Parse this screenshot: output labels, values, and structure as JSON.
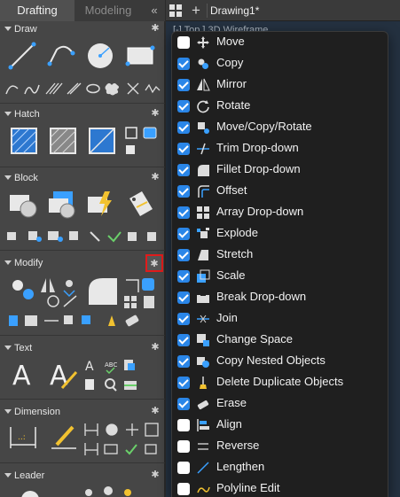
{
  "palette": {
    "tabs": [
      {
        "label": "Drafting",
        "active": true
      },
      {
        "label": "Modeling",
        "active": false
      }
    ],
    "collapse_glyph": "«",
    "sections": [
      {
        "title": "Draw",
        "gear_highlighted": false,
        "tools": [
          "line-icon",
          "polyline-icon",
          "circle-icon",
          "rectangle-icon",
          "arc-icon",
          "spline-icon",
          "hatch-lines-icon",
          "xline-icon",
          "ellipse-icon",
          "revision-cloud-icon",
          "construction-line-icon",
          "multiline-icon"
        ]
      },
      {
        "title": "Hatch",
        "gear_highlighted": false,
        "tools": [
          "hatch-icon",
          "gradient-icon",
          "boundary-icon",
          "region-icon",
          "wipeout-icon",
          "cover-icon"
        ]
      },
      {
        "title": "Block",
        "gear_highlighted": false,
        "tools": [
          "insert-block-icon",
          "create-block-icon",
          "block-editor-icon",
          "define-attributes-icon"
        ]
      },
      {
        "title": "Modify",
        "gear_highlighted": true,
        "tools": [
          "move-icon",
          "mirror-icon",
          "fillet-icon",
          "offset-icon",
          "rotate-icon",
          "trim-icon",
          "array-icon",
          "explode-icon",
          "stretch-icon",
          "scale-icon",
          "break-icon",
          "join-icon",
          "erase-icon"
        ]
      },
      {
        "title": "Text",
        "gear_highlighted": false,
        "tools": [
          "multiline-text-icon",
          "single-line-text-icon",
          "text-style-icon",
          "spell-check-icon",
          "find-icon",
          "table-icon"
        ]
      },
      {
        "title": "Dimension",
        "gear_highlighted": false,
        "tools": [
          "dimension-icon",
          "quick-dimension-icon",
          "linear-dim-icon",
          "aligned-dim-icon",
          "radius-dim-icon",
          "tolerance-icon"
        ]
      },
      {
        "title": "Leader",
        "gear_highlighted": false,
        "tools": [
          "leader-icon",
          "multileader-icon"
        ]
      }
    ]
  },
  "document": {
    "title": "Drawing1*",
    "viewport_label": "[-] Top ] 3D Wireframe"
  },
  "menu": {
    "items": [
      {
        "label": "Move",
        "checked": false,
        "icon": "move-icon"
      },
      {
        "label": "Copy",
        "checked": true,
        "icon": "copy-icon"
      },
      {
        "label": "Mirror",
        "checked": true,
        "icon": "mirror-icon"
      },
      {
        "label": "Rotate",
        "checked": true,
        "icon": "rotate-icon"
      },
      {
        "label": "Move/Copy/Rotate",
        "checked": true,
        "icon": "move-copy-rotate-icon"
      },
      {
        "label": "Trim Drop-down",
        "checked": true,
        "icon": "trim-icon"
      },
      {
        "label": "Fillet Drop-down",
        "checked": true,
        "icon": "fillet-icon"
      },
      {
        "label": "Offset",
        "checked": true,
        "icon": "offset-icon"
      },
      {
        "label": "Array Drop-down",
        "checked": true,
        "icon": "array-icon"
      },
      {
        "label": "Explode",
        "checked": true,
        "icon": "explode-icon"
      },
      {
        "label": "Stretch",
        "checked": true,
        "icon": "stretch-icon"
      },
      {
        "label": "Scale",
        "checked": true,
        "icon": "scale-icon"
      },
      {
        "label": "Break Drop-down",
        "checked": true,
        "icon": "break-icon"
      },
      {
        "label": "Join",
        "checked": true,
        "icon": "join-icon"
      },
      {
        "label": "Change Space",
        "checked": true,
        "icon": "change-space-icon"
      },
      {
        "label": "Copy Nested Objects",
        "checked": true,
        "icon": "copy-nested-icon"
      },
      {
        "label": "Delete Duplicate Objects",
        "checked": true,
        "icon": "delete-duplicates-icon"
      },
      {
        "label": "Erase",
        "checked": true,
        "icon": "erase-icon"
      },
      {
        "label": "Align",
        "checked": false,
        "icon": "align-icon"
      },
      {
        "label": "Reverse",
        "checked": false,
        "icon": "reverse-icon"
      },
      {
        "label": "Lengthen",
        "checked": false,
        "icon": "lengthen-icon"
      },
      {
        "label": "Polyline Edit",
        "checked": false,
        "icon": "polyline-edit-icon"
      }
    ]
  },
  "colors": {
    "accent": "#2a86e8",
    "highlight_border": "#e01b1b",
    "palette_bg": "#464646",
    "menu_bg": "#1f1f1f"
  }
}
